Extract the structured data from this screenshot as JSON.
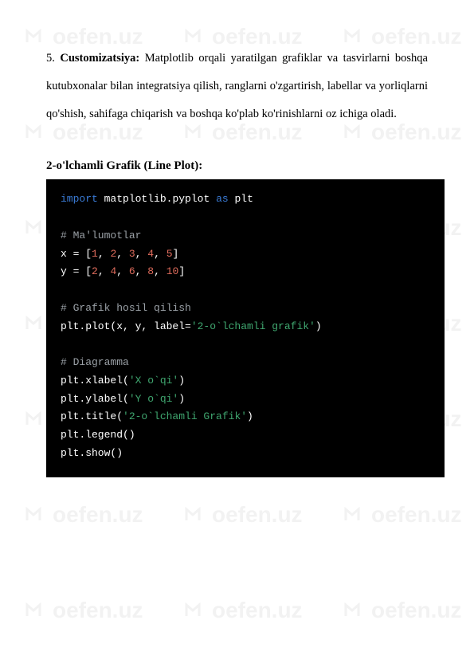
{
  "watermark": {
    "text": "oefen.uz"
  },
  "paragraph": {
    "num": "5.",
    "label": "Customizatsiya:",
    "body": " Matplotlib orqali yaratilgan grafiklar va tasvirlarni boshqa kutubxonalar bilan integratsiya qilish, ranglarni o'zgartirish, labellar va yorliqlarni qo'shish, sahifaga chiqarish va boshqa ko'plab ko'rinishlarni oz ichiga oladi."
  },
  "section_title": "2-o'lchamli Grafik (Line Plot):",
  "code": {
    "kw_import": "import",
    "module": "matplotlib.pyplot",
    "kw_as": "as",
    "alias": "plt",
    "c1": "# Ma'lumotlar",
    "x_pre": "x = [",
    "x1": "1",
    "x2": "2",
    "x3": "3",
    "x4": "4",
    "x5": "5",
    "x_post": "]",
    "y_pre": "y = [",
    "y1": "2",
    "y2": "4",
    "y3": "6",
    "y4": "8",
    "y5": "10",
    "y_post": "]",
    "c2": "# Grafik hosil qilish",
    "plot_pre": "plt.plot(x, y, label=",
    "plot_str": "'2-o`lchamli grafik'",
    "plot_post": ")",
    "c3": "# Diagramma",
    "xl_pre": "plt.xlabel(",
    "xl_str": "'X o`qi'",
    "xl_post": ")",
    "yl_pre": "plt.ylabel(",
    "yl_str": "'Y o`qi'",
    "yl_post": ")",
    "tt_pre": "plt.title(",
    "tt_str": "'2-o`lchamli Grafik'",
    "tt_post": ")",
    "legend": "plt.legend()",
    "show": "plt.show()"
  }
}
